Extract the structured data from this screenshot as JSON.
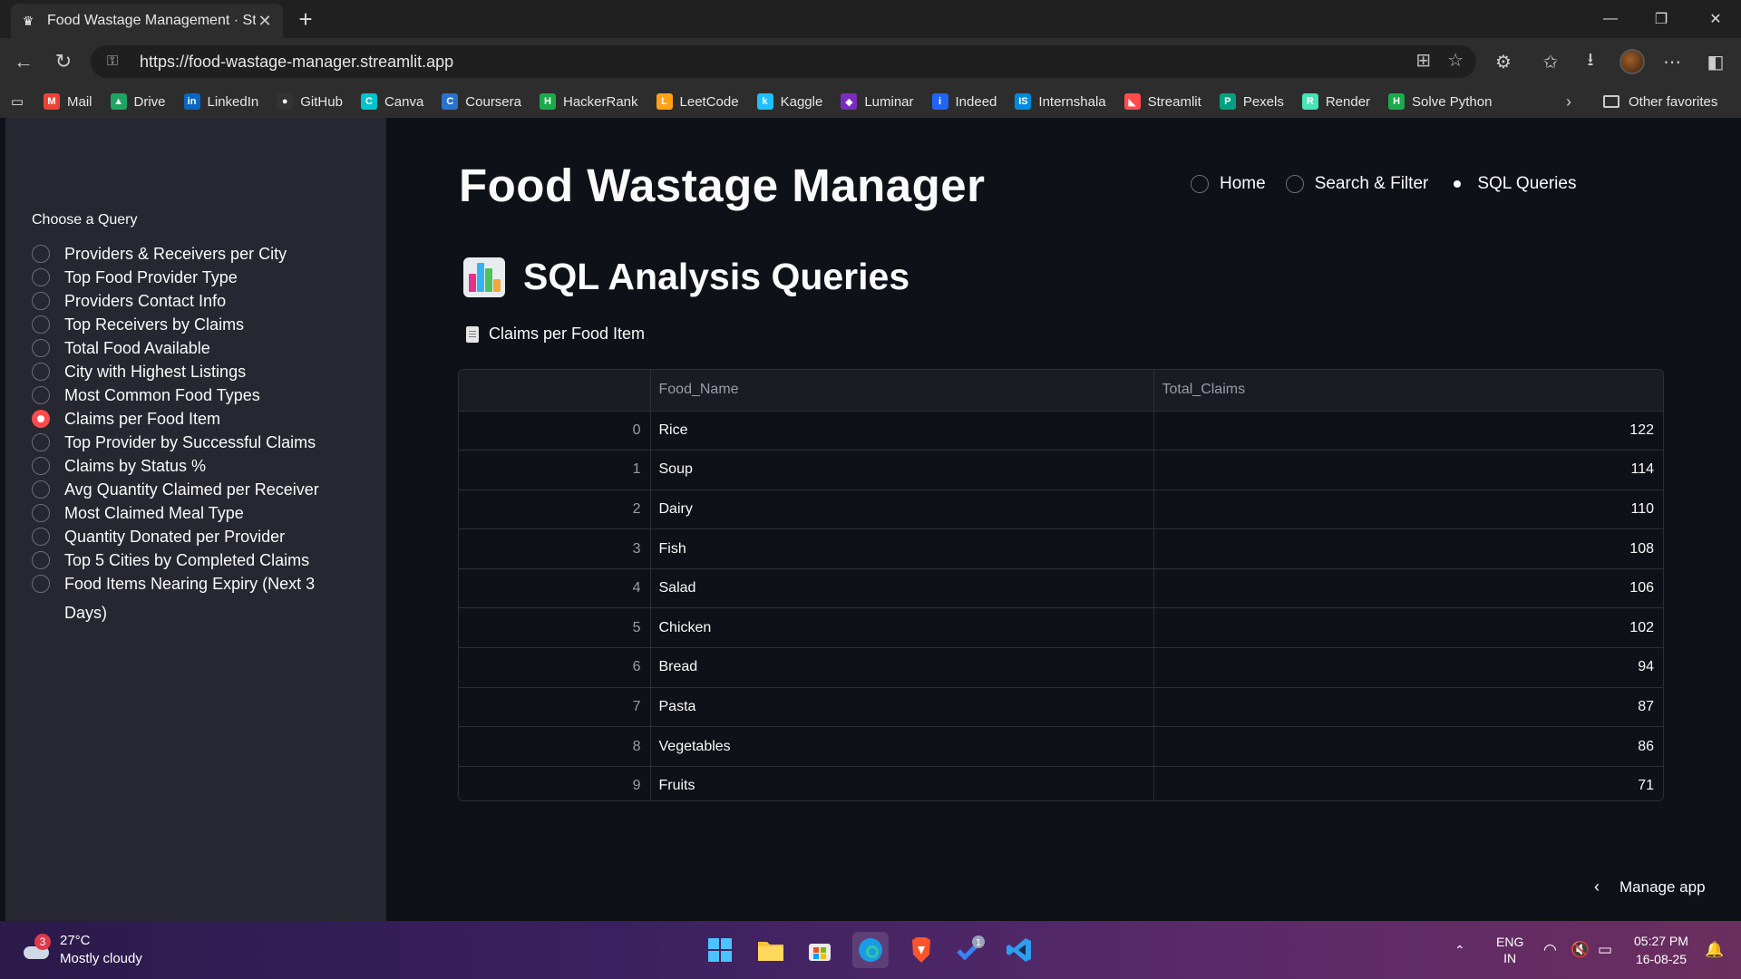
{
  "browser": {
    "tab_title": "Food Wastage Management · Streamlit",
    "url": "https://food-wastage-manager.streamlit.app",
    "bookmarks": [
      {
        "label": "Mail",
        "icon": "gmail-icon",
        "color": "#ea4335",
        "glyph": "M"
      },
      {
        "label": "Drive",
        "icon": "drive-icon",
        "color": "#1fa463",
        "glyph": "▲"
      },
      {
        "label": "LinkedIn",
        "icon": "linkedin-icon",
        "color": "#0a66c2",
        "glyph": "in"
      },
      {
        "label": "GitHub",
        "icon": "github-icon",
        "color": "#333333",
        "glyph": "●"
      },
      {
        "label": "Canva",
        "icon": "canva-icon",
        "color": "#00c4cc",
        "glyph": "C"
      },
      {
        "label": "Coursera",
        "icon": "coursera-icon",
        "color": "#2a73cc",
        "glyph": "C"
      },
      {
        "label": "HackerRank",
        "icon": "hackerrank-icon",
        "color": "#1ba94c",
        "glyph": "H"
      },
      {
        "label": "LeetCode",
        "icon": "leetcode-icon",
        "color": "#ffa116",
        "glyph": "L"
      },
      {
        "label": "Kaggle",
        "icon": "kaggle-icon",
        "color": "#20beff",
        "glyph": "k"
      },
      {
        "label": "Luminar",
        "icon": "luminar-icon",
        "color": "#7b2cbf",
        "glyph": "◆"
      },
      {
        "label": "Indeed",
        "icon": "indeed-icon",
        "color": "#2164f3",
        "glyph": "i"
      },
      {
        "label": "Internshala",
        "icon": "internshala-icon",
        "color": "#008bdc",
        "glyph": "IS"
      },
      {
        "label": "Streamlit",
        "icon": "streamlit-icon",
        "color": "#ff4b4b",
        "glyph": "◣"
      },
      {
        "label": "Pexels",
        "icon": "pexels-icon",
        "color": "#05a081",
        "glyph": "P"
      },
      {
        "label": "Render",
        "icon": "render-icon",
        "color": "#46e3b7",
        "glyph": "R"
      },
      {
        "label": "Solve Python",
        "icon": "solvepython-icon",
        "color": "#1ba94c",
        "glyph": "H"
      }
    ],
    "other_favorites": "Other favorites"
  },
  "sidebar": {
    "title": "Choose a Query",
    "items": [
      {
        "label": "Providers & Receivers per City",
        "selected": false
      },
      {
        "label": "Top Food Provider Type",
        "selected": false
      },
      {
        "label": "Providers Contact Info",
        "selected": false
      },
      {
        "label": "Top Receivers by Claims",
        "selected": false
      },
      {
        "label": "Total Food Available",
        "selected": false
      },
      {
        "label": "City with Highest Listings",
        "selected": false
      },
      {
        "label": "Most Common Food Types",
        "selected": false
      },
      {
        "label": "Claims per Food Item",
        "selected": true
      },
      {
        "label": "Top Provider by Successful Claims",
        "selected": false
      },
      {
        "label": "Claims by Status %",
        "selected": false
      },
      {
        "label": "Avg Quantity Claimed per Receiver",
        "selected": false
      },
      {
        "label": "Most Claimed Meal Type",
        "selected": false
      },
      {
        "label": "Quantity Donated per Provider",
        "selected": false
      },
      {
        "label": "Top 5 Cities by Completed Claims",
        "selected": false
      },
      {
        "label": "Food Items Nearing Expiry (Next 3 Days)",
        "selected": false
      }
    ]
  },
  "main": {
    "title": "Food Wastage Manager",
    "nav": [
      {
        "label": "Home",
        "selected": false
      },
      {
        "label": "Search & Filter",
        "selected": false
      },
      {
        "label": "SQL Queries",
        "selected": true
      }
    ],
    "section_title": "SQL Analysis Queries",
    "subheader": "Claims per Food Item",
    "table": {
      "columns": [
        "",
        "Food_Name",
        "Total_Claims"
      ],
      "rows": [
        {
          "index": "0",
          "food": "Rice",
          "claims": "122"
        },
        {
          "index": "1",
          "food": "Soup",
          "claims": "114"
        },
        {
          "index": "2",
          "food": "Dairy",
          "claims": "110"
        },
        {
          "index": "3",
          "food": "Fish",
          "claims": "108"
        },
        {
          "index": "4",
          "food": "Salad",
          "claims": "106"
        },
        {
          "index": "5",
          "food": "Chicken",
          "claims": "102"
        },
        {
          "index": "6",
          "food": "Bread",
          "claims": "94"
        },
        {
          "index": "7",
          "food": "Pasta",
          "claims": "87"
        },
        {
          "index": "8",
          "food": "Vegetables",
          "claims": "86"
        },
        {
          "index": "9",
          "food": "Fruits",
          "claims": "71"
        }
      ]
    },
    "manage_app": "Manage app"
  },
  "taskbar": {
    "weather_temp": "27°C",
    "weather_desc": "Mostly cloudy",
    "weather_badge": "3",
    "lang": "ENG",
    "region": "IN",
    "time": "05:27 PM",
    "date": "16-08-25",
    "pinned_badge": "1"
  },
  "colors": {
    "accent": "#ff4b4b",
    "background": "#0e1117",
    "sidebar": "#262730"
  }
}
